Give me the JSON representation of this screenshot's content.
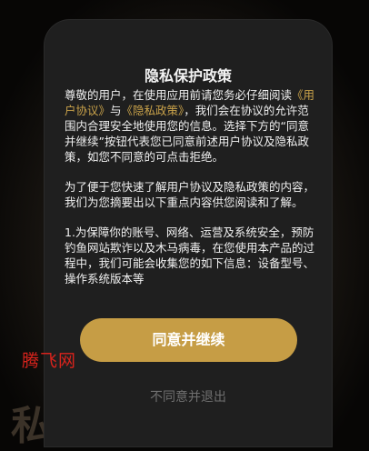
{
  "background": {
    "text": "私 放"
  },
  "dialog": {
    "title": "隐私保护政策",
    "paragraph1": {
      "intro": "尊敬的用户，在使用应用前请您务必仔细阅读",
      "link_user_agreement": "《用户协议》",
      "and": "与",
      "link_privacy": "《隐私政策》",
      "rest": "，我们会在协议的允许范围内合理安全地使用您的信息。选择下方的“同意并继续”按钮代表您已同意前述用户协议及隐私政策，如您不同意的可点击拒绝。"
    },
    "paragraph2": " 为了便于您快速了解用户协议及隐私政策的内容，我们为您摘要出以下重点内容供您阅读和了解。",
    "paragraph3": " 1.为保障你的账号、网络、运营及系统安全，预防钓鱼网站欺诈以及木马病毒，在您使用本产品的过程中，我们可能会收集您的如下信息：设备型号、操作系统版本等",
    "agree_label": "同意并继续",
    "decline_label": "不同意并退出"
  },
  "watermark": "腾飞网",
  "colors": {
    "accent": "#c69d45",
    "link": "#c9a24a",
    "dialog_bg": "#1f1f1f",
    "watermark": "#d8231c"
  }
}
